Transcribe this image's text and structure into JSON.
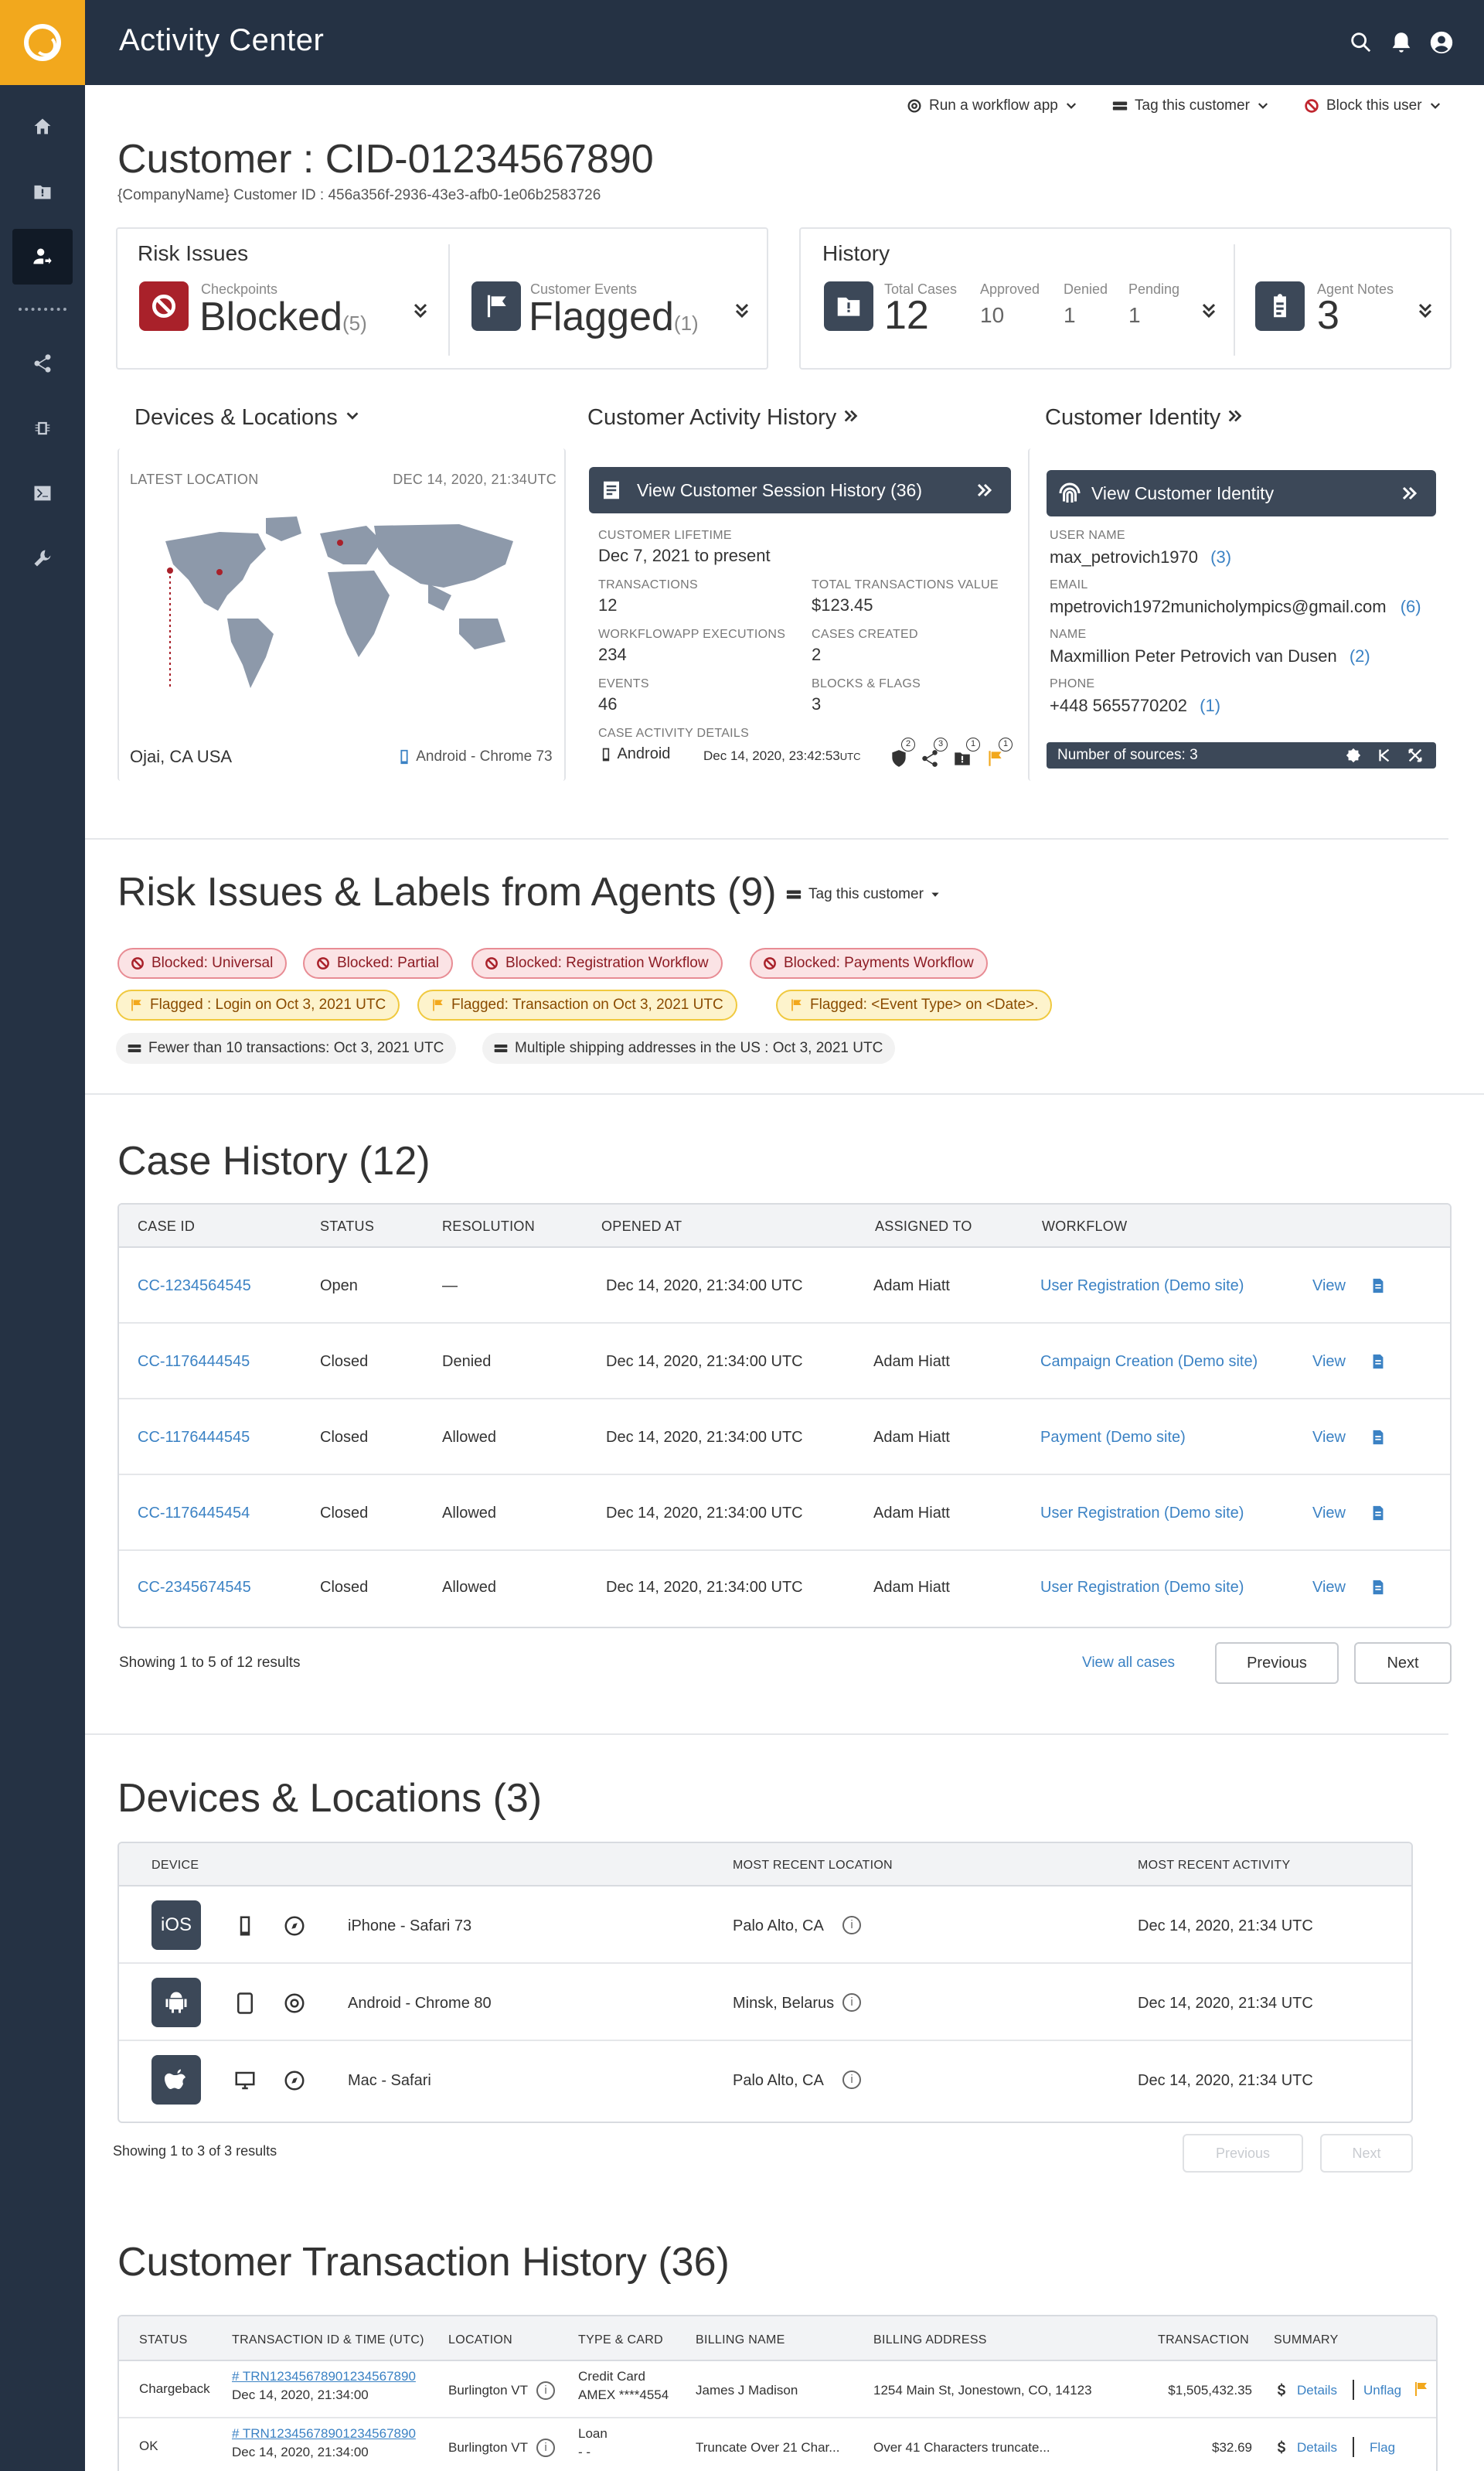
{
  "app": {
    "title": "Activity Center"
  },
  "actions": {
    "run": "Run a workflow app",
    "tag": "Tag this customer",
    "block": "Block this user"
  },
  "customer": {
    "title": "Customer : CID-01234567890",
    "subtitle": "{CompanyName} Customer ID : 456a356f-2936-43e3-afb0-1e06b2583726"
  },
  "risk": {
    "label": "Risk Issues",
    "checkpoints_label": "Checkpoints",
    "checkpoints_value": "Blocked",
    "checkpoints_count": "(5)",
    "events_label": "Customer Events",
    "events_value": "Flagged",
    "events_count": "(1)"
  },
  "history": {
    "label": "History",
    "total_label": "Total Cases",
    "total": "12",
    "approved_label": "Approved",
    "approved": "10",
    "denied_label": "Denied",
    "denied": "1",
    "pending_label": "Pending",
    "pending": "1",
    "notes_label": "Agent Notes",
    "notes": "3"
  },
  "devloc": {
    "heading": "Devices & Locations",
    "latest_label": "LATEST LOCATION",
    "latest_time": "DEC 14, 2020, 21:34UTC",
    "place": "Ojai, CA USA",
    "device": "Android - Chrome 73"
  },
  "activity": {
    "heading": "Customer Activity History",
    "button": "View Customer Session History (36)",
    "lifetime_label": "CUSTOMER LIFETIME",
    "lifetime": "Dec 7, 2021 to present",
    "tx_label": "TRANSACTIONS",
    "tx": "12",
    "txval_label": "TOTAL TRANSACTIONS VALUE",
    "txval": "$123.45",
    "wf_label": "WORKFLOWAPP EXECUTIONS",
    "wf": "234",
    "cases_label": "CASES CREATED",
    "cases": "2",
    "events_label": "EVENTS",
    "events": "46",
    "blocks_label": "BLOCKS & FLAGS",
    "blocks": "3",
    "case_label": "CASE ACTIVITY DETAILS",
    "case_device": "Android",
    "case_time": "Dec 14, 2020, 23:42:53",
    "case_tz": "UTC",
    "badges": [
      "2",
      "3",
      "1",
      "1"
    ]
  },
  "identity": {
    "heading": "Customer Identity",
    "button": "View Customer Identity",
    "user_label": "USER NAME",
    "user": "max_petrovich1970",
    "user_n": "(3)",
    "email_label": "EMAIL",
    "email": "mpetrovich1972municholympics@gmail.com",
    "email_n": "(6)",
    "name_label": "NAME",
    "name": "Maxmillion Peter Petrovich van Dusen",
    "name_n": "(2)",
    "phone_label": "PHONE",
    "phone": "+448 5655770202",
    "phone_n": "(1)",
    "sources": "Number of sources: 3"
  },
  "labels": {
    "heading": "Risk Issues & Labels from Agents (9)",
    "tag_action": "Tag this customer",
    "red": [
      "Blocked: Universal",
      "Blocked: Partial",
      "Blocked: Registration Workflow",
      "Blocked: Payments Workflow"
    ],
    "yellow": [
      "Flagged : Login on Oct 3, 2021 UTC",
      "Flagged: Transaction on Oct 3, 2021 UTC",
      "Flagged: <Event Type> on <Date>."
    ],
    "gray": [
      "Fewer than 10 transactions: Oct 3, 2021 UTC",
      "Multiple shipping addresses in the US : Oct 3, 2021 UTC"
    ]
  },
  "cases": {
    "heading": "Case History (12)",
    "columns": [
      "CASE ID",
      "STATUS",
      "RESOLUTION",
      "OPENED AT",
      "ASSIGNED TO",
      "WORKFLOW"
    ],
    "rows": [
      {
        "id": "CC-1234564545",
        "status": "Open",
        "resolution": "—",
        "opened": "Dec 14, 2020, 21:34:00 UTC",
        "assigned": "Adam Hiatt",
        "workflow": "User Registration (Demo site)",
        "view": "View"
      },
      {
        "id": "CC-1176444545",
        "status": "Closed",
        "resolution": "Denied",
        "opened": "Dec 14, 2020, 21:34:00 UTC",
        "assigned": "Adam Hiatt",
        "workflow": "Campaign Creation (Demo site)",
        "view": "View"
      },
      {
        "id": "CC-1176444545",
        "status": "Closed",
        "resolution": "Allowed",
        "opened": "Dec 14, 2020, 21:34:00 UTC",
        "assigned": "Adam Hiatt",
        "workflow": "Payment (Demo site)",
        "view": "View"
      },
      {
        "id": "CC-1176445454",
        "status": "Closed",
        "resolution": "Allowed",
        "opened": "Dec 14, 2020, 21:34:00 UTC",
        "assigned": "Adam Hiatt",
        "workflow": "User Registration (Demo site)",
        "view": "View"
      },
      {
        "id": "CC-2345674545",
        "status": "Closed",
        "resolution": "Allowed",
        "opened": "Dec 14, 2020, 21:34:00 UTC",
        "assigned": "Adam Hiatt",
        "workflow": "User Registration (Demo site)",
        "view": "View"
      }
    ],
    "showing": "Showing 1 to 5 of 12 results",
    "view_all": "View all cases",
    "prev": "Previous",
    "next": "Next"
  },
  "devices": {
    "heading": "Devices & Locations (3)",
    "columns": [
      "DEVICE",
      "MOST RECENT LOCATION",
      "MOST RECENT ACTIVITY"
    ],
    "rows": [
      {
        "os": "iOS",
        "name": "iPhone - Safari 73",
        "location": "Palo Alto, CA",
        "activity": "Dec 14, 2020, 21:34 UTC"
      },
      {
        "os": "android",
        "name": "Android - Chrome 80",
        "location": "Minsk, Belarus",
        "activity": "Dec 14, 2020, 21:34 UTC"
      },
      {
        "os": "apple",
        "name": "Mac - Safari",
        "location": "Palo Alto, CA",
        "activity": "Dec 14, 2020, 21:34 UTC"
      }
    ],
    "showing": "Showing 1 to 3 of 3 results",
    "prev": "Previous",
    "next": "Next"
  },
  "transactions": {
    "heading": "Customer Transaction History (36)",
    "columns": [
      "STATUS",
      "TRANSACTION ID & TIME (UTC)",
      "LOCATION",
      "TYPE & CARD",
      "BILLING NAME",
      "BILLING ADDRESS",
      "TRANSACTION",
      "SUMMARY"
    ],
    "rows": [
      {
        "status": "Chargeback",
        "id": "# TRN12345678901234567890",
        "time": "Dec 14, 2020, 21:34:00",
        "location": "Burlington VT",
        "type": "Credit Card",
        "card": "AMEX ****4554",
        "billing_name": "James J Madison",
        "address": "1254 Main St, Jonestown, CO, 14123",
        "amount": "$1,505,432.35",
        "details": "Details",
        "flag": "Unflag"
      },
      {
        "status": "OK",
        "id": "# TRN12345678901234567890",
        "time": "Dec 14, 2020, 21:34:00",
        "location": "Burlington VT",
        "type": "Loan",
        "card": "- -",
        "billing_name": "Truncate Over 21 Char...",
        "address": "Over 41 Characters truncate...",
        "amount": "$32.69",
        "details": "Details",
        "flag": "Flag"
      }
    ]
  }
}
